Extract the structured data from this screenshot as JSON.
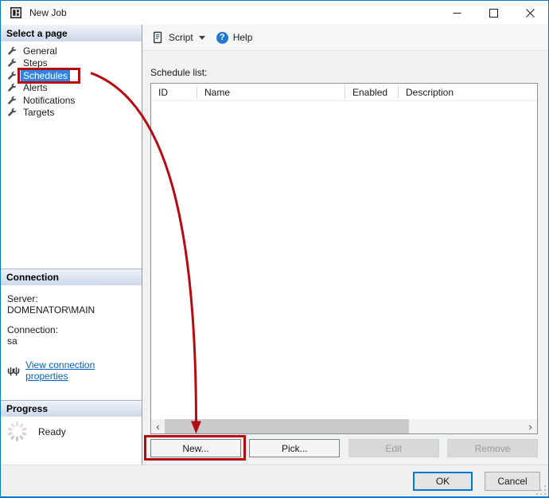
{
  "titlebar": {
    "title": "New Job"
  },
  "sidebar": {
    "header": "Select a page",
    "pages": [
      {
        "label": "General"
      },
      {
        "label": "Steps"
      },
      {
        "label": "Schedules",
        "selected": true
      },
      {
        "label": "Alerts"
      },
      {
        "label": "Notifications"
      },
      {
        "label": "Targets"
      }
    ],
    "connection": {
      "header": "Connection",
      "server_label": "Server:",
      "server_value": "DOMENATOR\\MAIN",
      "connection_label": "Connection:",
      "connection_value": "sa",
      "icon_glyph": "ψψ",
      "link": "View connection properties"
    },
    "progress": {
      "header": "Progress",
      "status": "Ready"
    }
  },
  "toolbar": {
    "script": "Script",
    "help": "Help",
    "help_glyph": "?"
  },
  "content": {
    "schedule_list_label": "Schedule list:",
    "table": {
      "columns": [
        "ID",
        "Name",
        "Enabled",
        "Description"
      ],
      "rows": []
    },
    "scrollbar": {
      "left_glyph": "‹",
      "right_glyph": "›"
    },
    "buttons": [
      {
        "label": "New...",
        "enabled": true,
        "highlighted": true
      },
      {
        "label": "Pick...",
        "enabled": true
      },
      {
        "label": "Edit",
        "enabled": false
      },
      {
        "label": "Remove",
        "enabled": false
      }
    ]
  },
  "footer": {
    "ok": "OK",
    "cancel": "Cancel"
  },
  "colors": {
    "window_border": "#0078d7",
    "selection_blue": "#2e86e2",
    "annotation_red": "#b40a10",
    "link_blue": "#0563c1",
    "header_gradient_bottom": "#ccd9ea"
  }
}
